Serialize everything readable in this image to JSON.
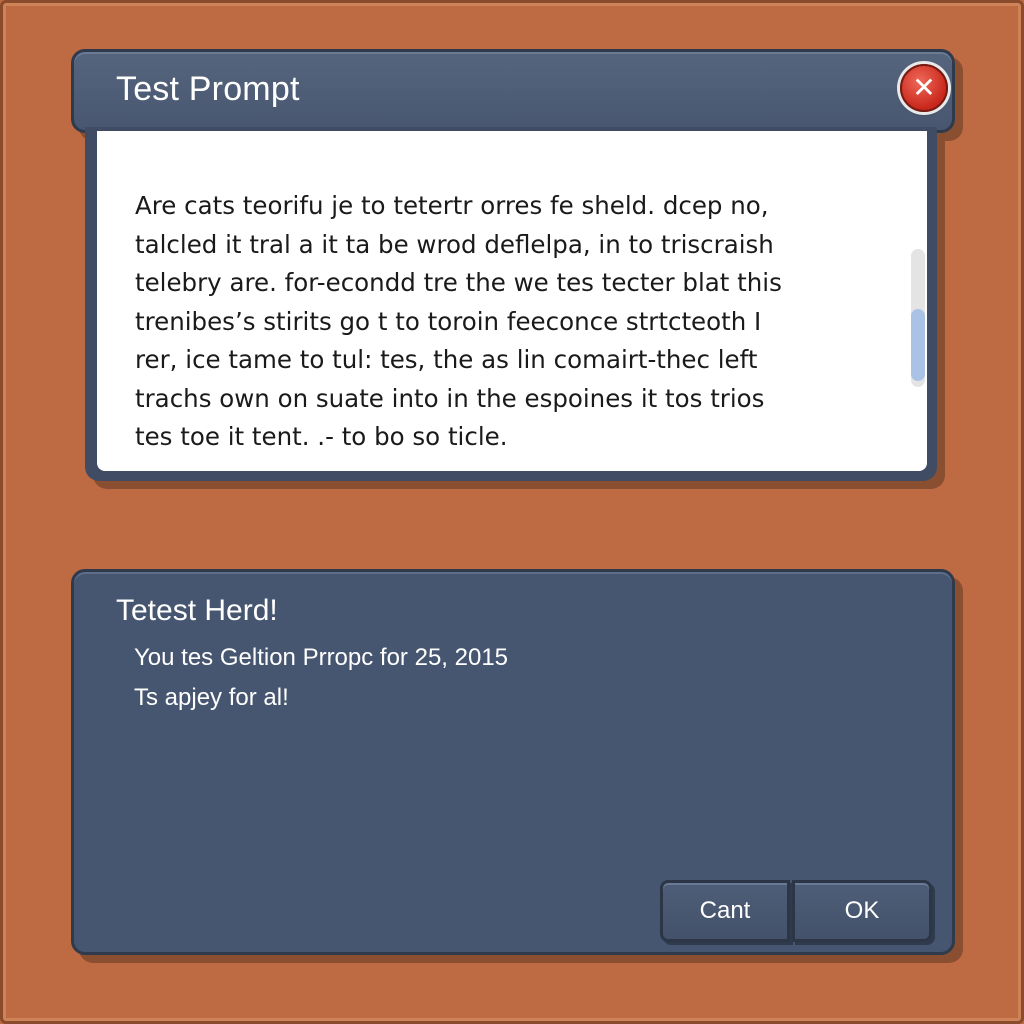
{
  "dialog": {
    "title": "Test Prompt",
    "close_icon": "close-icon",
    "close_glyph": "✕",
    "body_lines": [
      "Are cats teorifu je to tetertr orres fe sheld. dcep no,",
      "talcled it tral a it ta be wrod deflelpa, in to triscraish",
      "telebry are. for-econdd tre the we tes tecter blat this",
      "trenibes’s stirits go t to toroin feeconce strtcteoth I",
      "rer, ice tame to tul: tes, the as lin comairt-thec left",
      "trachs own on suate into in the espoines it tos trios",
      "tes toe it tent.  .-  to bo so ticle."
    ]
  },
  "panel": {
    "title": "Tetest Herd!",
    "line1": "You tes Geltion Prropc for 25, 2015",
    "line2": "Ts apjey for al!",
    "cancel_label": "Cant",
    "ok_label": "OK"
  },
  "colors": {
    "background": "#be6b44",
    "panel": "#475670",
    "close_button": "#d9352a"
  }
}
